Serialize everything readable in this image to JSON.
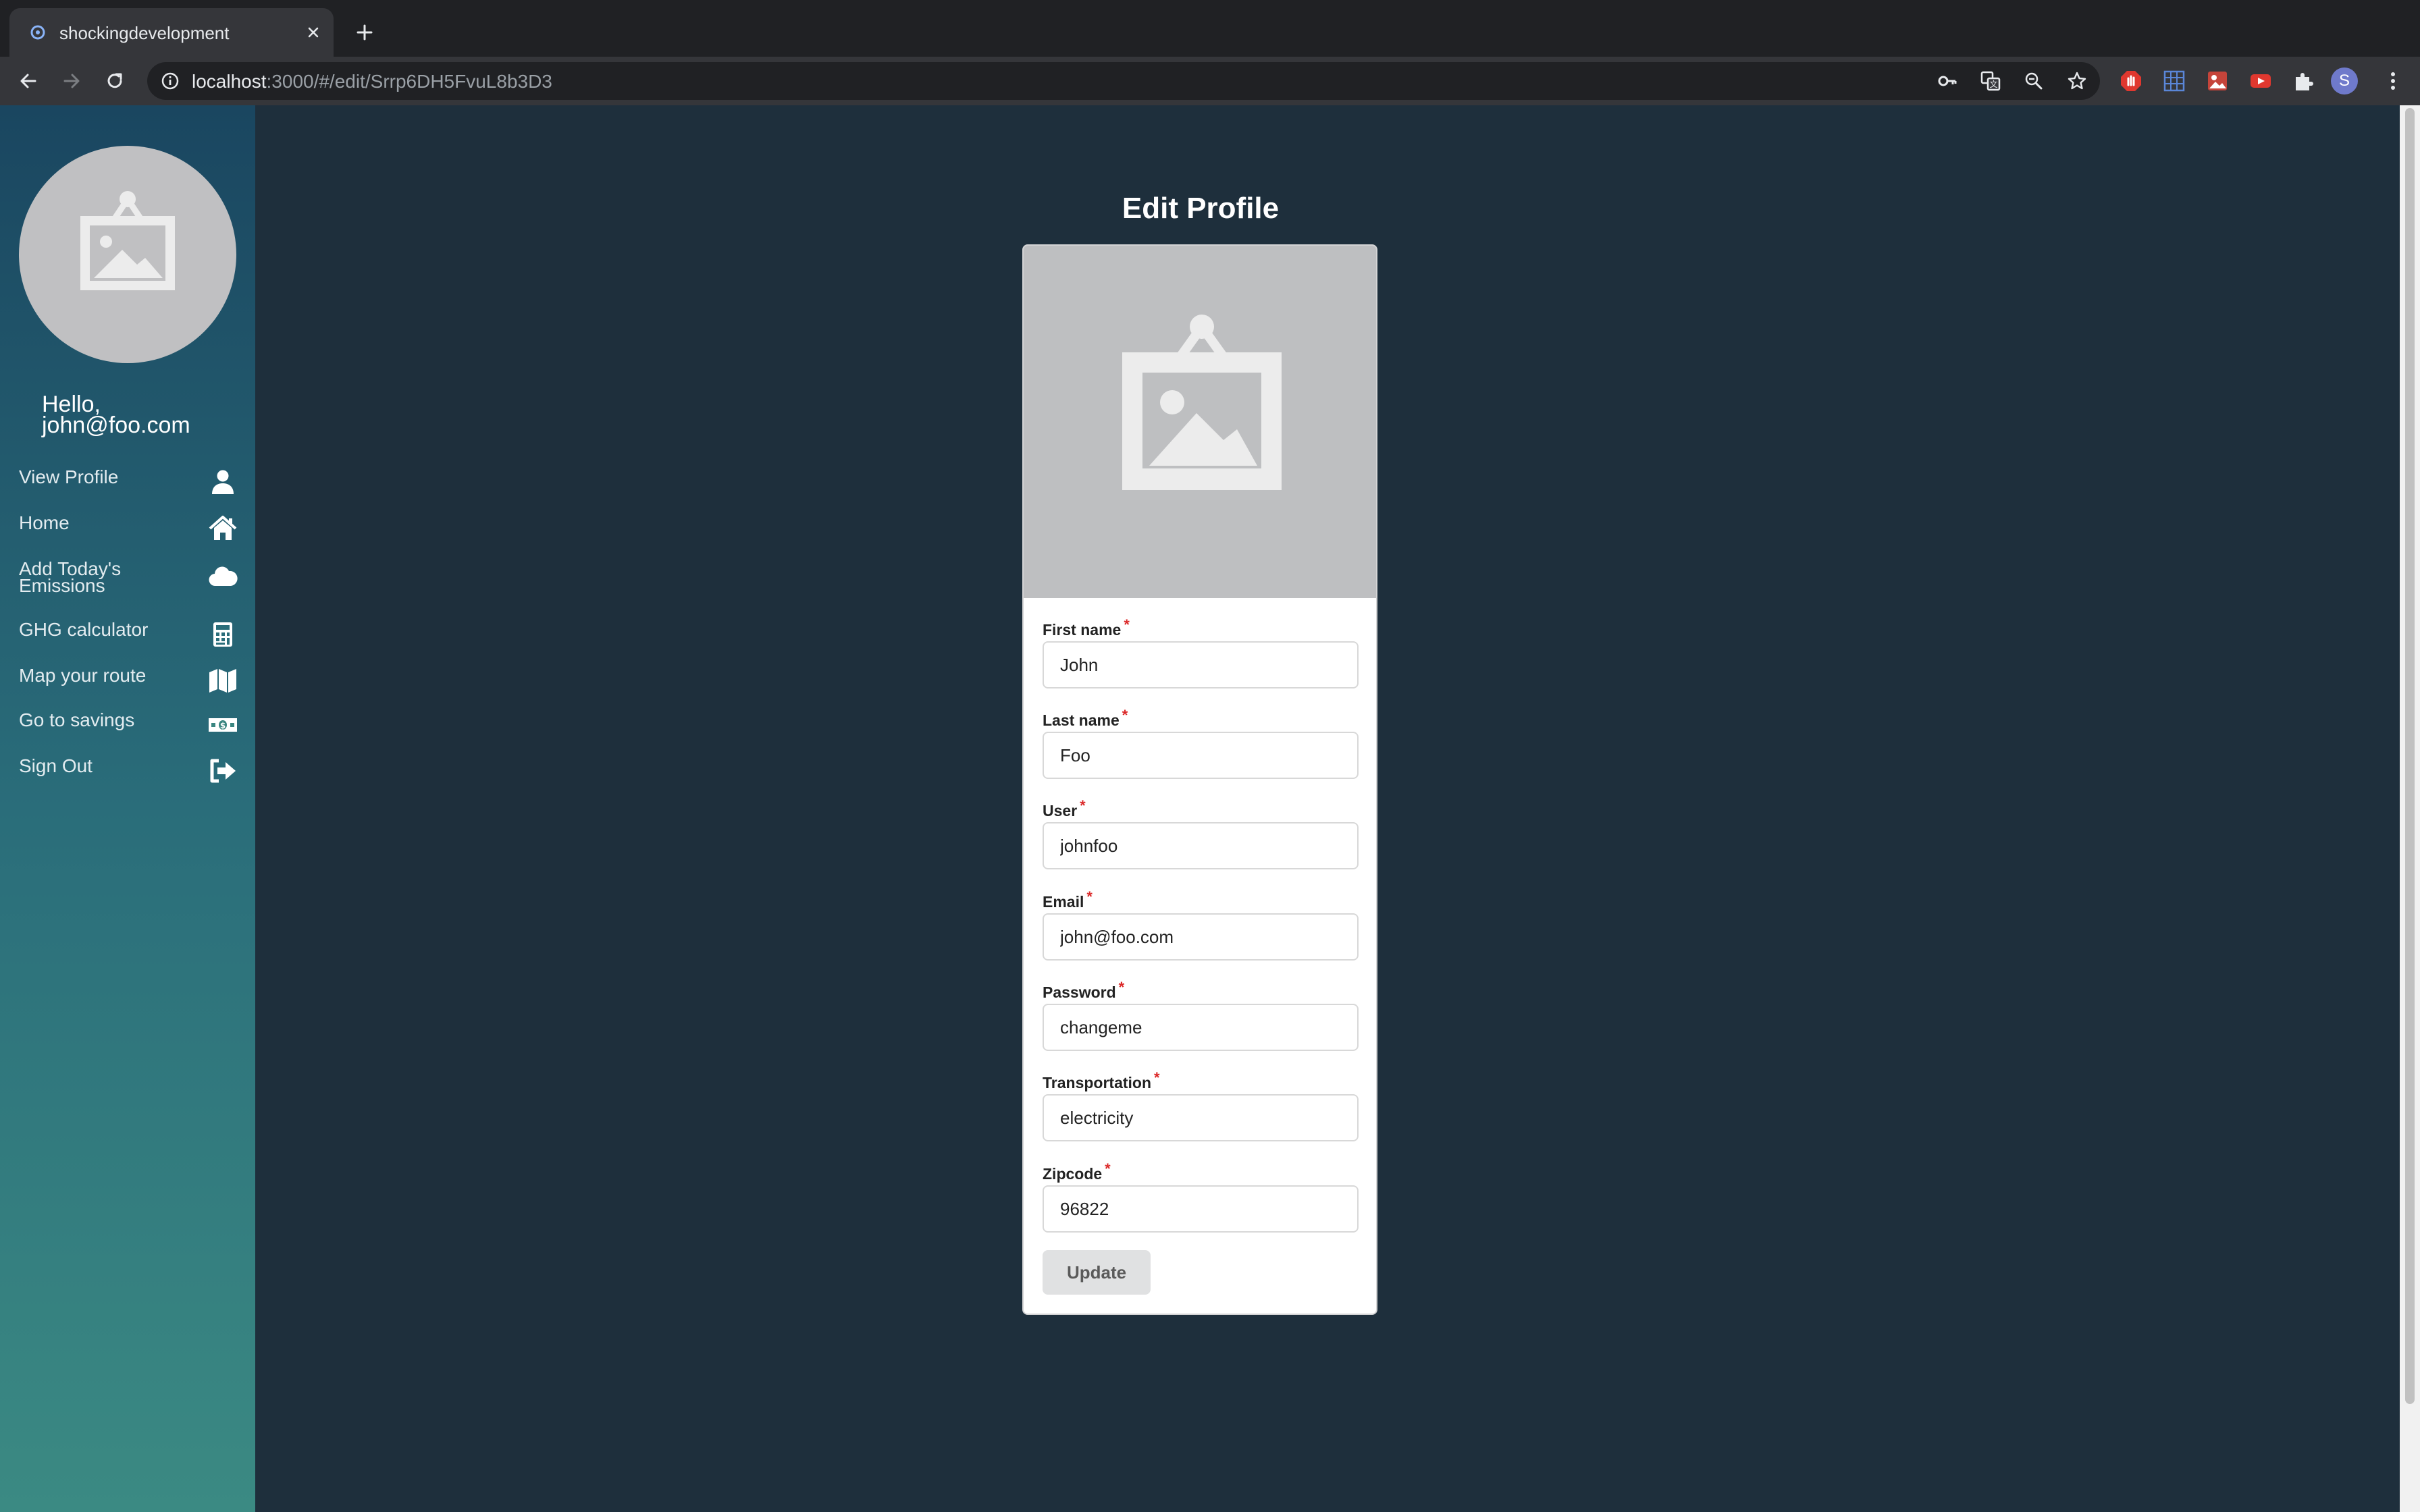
{
  "browser": {
    "tab_title": "shockingdevelopment",
    "url_host": "localhost",
    "url_path": ":3000/#/edit/Srrp6DH5FvuL8b3D3",
    "profile_initial": "S"
  },
  "sidebar": {
    "greeting_line1": "Hello,",
    "greeting_line2": "john@foo.com",
    "items": [
      {
        "label": "View Profile",
        "icon": "user-icon"
      },
      {
        "label": "Home",
        "icon": "home-icon"
      },
      {
        "label_line1": "Add Today's",
        "label_line2": "Emissions",
        "icon": "cloud-icon"
      },
      {
        "label": "GHG calculator",
        "icon": "calculator-icon"
      },
      {
        "label": "Map your route",
        "icon": "map-icon"
      },
      {
        "label": "Go to savings",
        "icon": "money-icon"
      },
      {
        "label": "Sign Out",
        "icon": "sign-out-icon"
      }
    ]
  },
  "page": {
    "title": "Edit Profile"
  },
  "form": {
    "required_marker": "*",
    "fields": [
      {
        "label": "First name",
        "value": "John"
      },
      {
        "label": "Last name",
        "value": "Foo"
      },
      {
        "label": "User",
        "value": "johnfoo"
      },
      {
        "label": "Email",
        "value": "john@foo.com"
      },
      {
        "label": "Password",
        "value": "changeme"
      },
      {
        "label": "Transportation",
        "value": "electricity"
      },
      {
        "label": "Zipcode",
        "value": "96822"
      }
    ],
    "submit_label": "Update"
  },
  "colors": {
    "sidebar_top": "#1a4660",
    "sidebar_bottom": "#3b8a83",
    "main_background": "#1e2f3c",
    "required": "#db2828"
  }
}
